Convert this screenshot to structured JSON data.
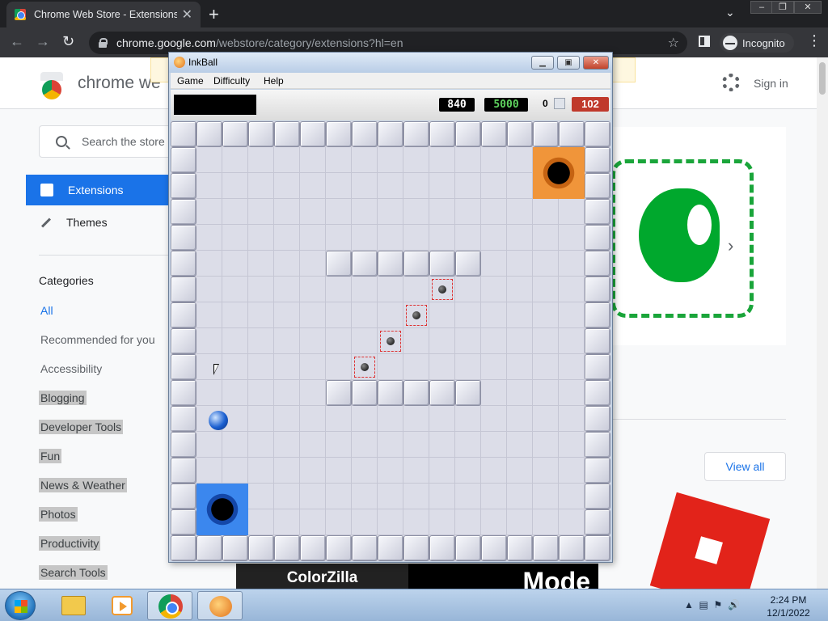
{
  "browser": {
    "tab_title": "Chrome Web Store - Extensions",
    "url_host": "chrome.google.com",
    "url_path": "/webstore/category/extensions?hl=en",
    "profile_label": "Incognito"
  },
  "webstore": {
    "brand": "chrome we",
    "signin": "Sign in",
    "search_placeholder": "Search the store",
    "nav": {
      "extensions": "Extensions",
      "themes": "Themes"
    },
    "categories_title": "Categories",
    "categories": [
      "All",
      "Recommended for you",
      "Accessibility",
      "Blogging",
      "Developer Tools",
      "Fun",
      "News & Weather",
      "Photos",
      "Productivity",
      "Search Tools"
    ],
    "view_all": "View all",
    "tiles": {
      "colorzilla": "ColorZilla",
      "mode": "Mode"
    }
  },
  "inkball": {
    "title": "InkBall",
    "menu": [
      "Game",
      "Difficulty",
      "Help"
    ],
    "score_current": "840",
    "score_target": "5000",
    "lives": "0",
    "timer": "102",
    "colors": {
      "current_score": "#ffffff",
      "target_score": "#5fd35f",
      "timer_bg": "#c0392b"
    }
  },
  "taskbar": {
    "time": "2:24 PM",
    "date": "12/1/2022"
  },
  "icons": [
    "favicon-icon",
    "close-icon",
    "plus-icon",
    "chevron-down-icon",
    "back-icon",
    "forward-icon",
    "reload-icon",
    "lock-icon",
    "star-icon",
    "side-panel-icon",
    "incognito-icon",
    "kebab-menu-icon",
    "gear-icon",
    "search-icon",
    "puzzle-icon",
    "brush-icon",
    "elephant-icon",
    "chevron-right-icon",
    "cursor-icon",
    "start-orb-icon",
    "folder-icon",
    "media-player-icon",
    "chrome-icon",
    "inkball-icon"
  ]
}
